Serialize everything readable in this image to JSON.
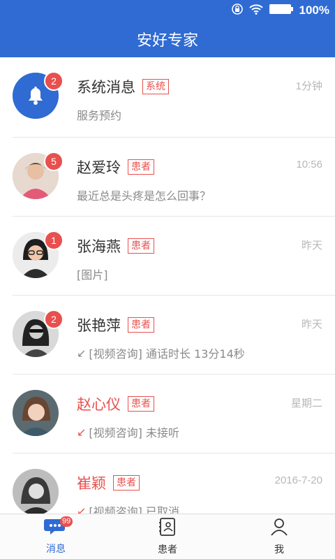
{
  "status_bar": {
    "battery_text": "100%"
  },
  "header": {
    "title": "安好专家"
  },
  "messages": [
    {
      "name": "系统消息",
      "tag": "系统",
      "time": "1分钟",
      "badge": "2",
      "preview": "服务预约",
      "avatar": "bell-icon",
      "missed": false
    },
    {
      "name": "赵爱玲",
      "tag": "患者",
      "time": "10:56",
      "badge": "5",
      "preview": "最近总是头疼是怎么回事？",
      "avatar": "patient-avatar",
      "missed": false
    },
    {
      "name": "张海燕",
      "tag": "患者",
      "time": "昨天",
      "badge": "1",
      "preview": "[图片]",
      "avatar": "patient-avatar",
      "missed": false
    },
    {
      "name": "张艳萍",
      "tag": "患者",
      "time": "昨天",
      "badge": "2",
      "preview": "[视频咨询] 通话时长 13分14秒",
      "avatar": "patient-avatar",
      "missed": false
    },
    {
      "name": "赵心仪",
      "tag": "患者",
      "time": "星期二",
      "badge": "",
      "preview": "[视频咨询] 未接听",
      "avatar": "patient-avatar",
      "missed": true
    },
    {
      "name": "崔颖",
      "tag": "患者",
      "time": "2016-7-20",
      "badge": "",
      "preview": "[视频咨询] 已取消",
      "avatar": "patient-avatar",
      "missed": true
    }
  ],
  "tabs": [
    {
      "label": "消息",
      "badge": "99",
      "icon": "chat-bubble-icon",
      "active": true
    },
    {
      "label": "患者",
      "icon": "patient-book-icon",
      "active": false
    },
    {
      "label": "我",
      "icon": "person-icon",
      "active": false
    }
  ],
  "colors": {
    "primary": "#2f6bd3",
    "accent_red": "#e8504e"
  }
}
